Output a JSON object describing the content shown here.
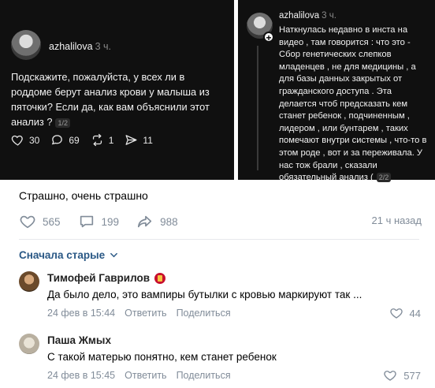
{
  "thread_left": {
    "username": "azhalilova",
    "time": "3 ч.",
    "text": "Подскажите, пожалуйста, у всех ли в роддоме берут анализ крови у малыша из пяточки? Если да, как вам объяснили этот анализ ?",
    "pager": "1/2",
    "likes": "30",
    "comments": "69",
    "reposts": "1",
    "shares": "11"
  },
  "thread_right": {
    "username": "azhalilova",
    "time": "3 ч.",
    "text": "Наткнулась недавно в инста на видео , там говорится : что это - Сбор генетических слепков младенцев , не для медицины , а для базы данных закрытых от гражданского доступа . Эта делается чтоб предсказать кем станет ребенок , подчиненным , лидером , или бунтарем , таких помечают внутри системы , что-то в этом роде , вот и за переживала. У нас тож брали , сказали обязательный анализ (",
    "pager": "2/2"
  },
  "post": {
    "caption": "Страшно, очень страшно",
    "likes": "565",
    "comments": "199",
    "shares": "988",
    "time": "21 ч назад"
  },
  "comments_sort": "Сначала старые",
  "comments": [
    {
      "name": "Тимофей Гаврилов",
      "text": "Да было дело, это вампиры бутылки с кровью маркируют так ...",
      "date": "24 фев в 15:44",
      "reply": "Ответить",
      "share": "Поделиться",
      "likes": "44"
    },
    {
      "name": "Паша Жмых",
      "text": "С такой матерью понятно, кем станет ребенок",
      "date": "24 фев в 15:45",
      "reply": "Ответить",
      "share": "Поделиться",
      "likes": "577"
    }
  ],
  "colors": {
    "link": "#2a5885",
    "meta": "#818c99",
    "dark_bg": "#101010"
  }
}
